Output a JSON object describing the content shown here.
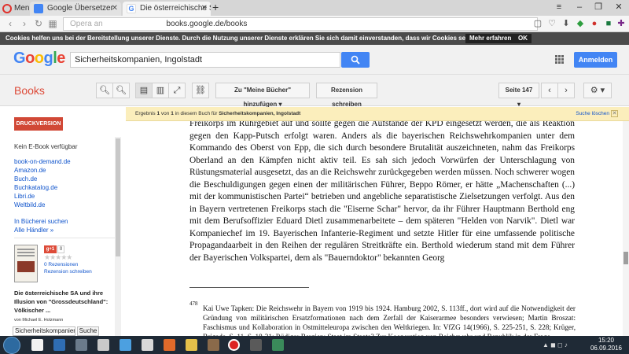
{
  "browser": {
    "menu_label": "Menü",
    "tabs": [
      {
        "title": "Google Übersetzer"
      },
      {
        "title": "Die österreichische SA und"
      }
    ],
    "url": "books.google.de/books",
    "url_hint": "Opera an",
    "colors": {
      "tabbar": "#d6d6d6",
      "active_tab": "#f5f5f5"
    }
  },
  "cookie_bar": {
    "message": "Cookies helfen uns bei der Bereitstellung unserer Dienste. Durch die Nutzung unserer Dienste erklären Sie sich damit einverstanden, dass wir Cookies setzen.",
    "more_label": "Mehr erfahren",
    "ok_label": "OK"
  },
  "header": {
    "logo": "Google",
    "search_value": "Sicherheitskompanien, Ingolstadt",
    "signin_label": "Anmelden",
    "colors": {
      "primary": "#4285f4",
      "red": "#dd4b39"
    }
  },
  "toolbar": {
    "title": "Books",
    "add_label": "Zu \"Meine Bücher\" hinzufügen",
    "review_label": "Rezension schreiben",
    "page_label": "Seite 147"
  },
  "sidebar": {
    "print_label": "DRUCKVERSION",
    "no_ebook": "Kein E-Book verfügbar",
    "shops": [
      "book-on-demand.de",
      "Amazon.de",
      "Buch.de",
      "Buchkatalog.de",
      "Libri.de",
      "Weltbild.de"
    ],
    "library_link": "In Bücherei suchen",
    "all_dealers": "Alle Händler »",
    "gplus_count": "0",
    "reviews": "0 Rezensionen",
    "write_review": "Rezension schreiben",
    "book_title": "Die österreichische SA und ihre Illusion von \"Grossdeutschland\": Völkischer ...",
    "author": "von Michael E. Holzmann",
    "search_value": "Sicherheitskompanien",
    "search_button": "Suche"
  },
  "banner": {
    "prefix": "Ergebnis ",
    "result": "1",
    "middle": " von ",
    "total": "1",
    "suffix": " in diesem Buch für ",
    "query": "Sicherheitskompanien, Ingolstadt",
    "clear_label": "Suche löschen"
  },
  "page": {
    "text": [
      "Freikorps im Ruhrgebiet auf und sollte gegen die Aufstände der KPD eingesetzt werden, die als Reaktion gegen den Kapp-Putsch erfolgt waren. Anders als die bayerischen Reichswehrkompanien unter dem Kommando des Oberst von Epp, die sich durch besondere Brutalität auszeichneten, nahm das Freikorps Oberland an den Kämpfen nicht aktiv teil. Es sah sich jedoch Vorwürfen der Unterschlagung von Rüstungsmaterial ausgesetzt, das an die Reichswehr zurückgegeben werden müssen. Noch schwerer wogen die Beschuldigungen gegen einen der militärischen Führer, Beppo Römer, er hätte „Machenschaften (...) mit der kommunistischen Partei“ betrieben und angebliche separatistische Zielsetzungen verfolgt. Aus den in Bayern vertretenen Freikorps stach die \"Eiserne Schar\" hervor, da ihr Führer Hauptmann Berthold eng mit dem Berufsoffizier Eduard Dietl zusammenarbeitete – dem späteren \"Helden von Narvik\". Dietl war Kompaniechef im 19. Bayerischen Infanterie-Regiment und setzte Hitler für eine umfassende politische Propagandaarbeit in den Reihen der regulären Streitkräfte ein. Berthold wiederum stand mit dem Führer der Bayerischen Volkspartei, dem als \"Bauerndoktor\" bekannten Georg"
    ],
    "footnote_number": "478",
    "footnote": "Kai Uwe Tapken: Die Reichswehr in Bayern von 1919 bis 1924. Hamburg 2002, S. 113ff., dort wird auf die Notwendigkeit der Gründung von militärischen Ersatzformationen nach dem Zerfall der Kaiserarmee besonders verwiesen; Martin Broszat: Faschismus und Kollaboration in Ostmitteleuropa zwischen den Weltkriegen. In: VfZG 14(1966), S. 225-251, S. 228; Krüger, Brigade, S. 11, S. 18-31; Rüdiger Bergien: Staat im Staate? Zur Kooperation von Reichswehr und Republik in der Frage"
  },
  "taskbar": {
    "time": "15:20",
    "date": "06.09.2016"
  }
}
